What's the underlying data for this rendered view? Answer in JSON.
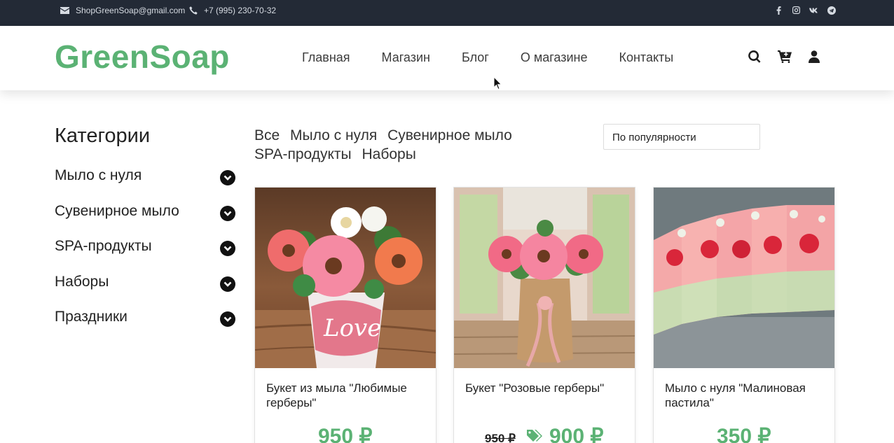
{
  "topbar": {
    "email": "ShopGreenSoap@gmail.com",
    "phone": "+7 (995) 230-70-32",
    "social_icons": [
      "facebook-icon",
      "instagram-icon",
      "vk-icon",
      "telegram-icon"
    ]
  },
  "header": {
    "logo": "GreenSoap",
    "nav": [
      "Главная",
      "Магазин",
      "Блог",
      "О магазине",
      "Контакты"
    ],
    "icons": [
      "search-icon",
      "cart-icon",
      "user-icon"
    ]
  },
  "sidebar": {
    "title": "Категории",
    "categories": [
      "Мыло с нуля",
      "Сувенирное мыло",
      "SPA-продукты",
      "Наборы",
      "Праздники"
    ]
  },
  "filters": {
    "tabs": [
      "Все",
      "Мыло с нуля",
      "Сувенирное мыло",
      "SPA-продукты",
      "Наборы"
    ],
    "sort_value": "По популярности"
  },
  "products": [
    {
      "name": "Букет из мыла \"Любимые герберы\"",
      "price": "950 ₽"
    },
    {
      "name": "Букет \"Розовые герберы\"",
      "old_price": "950 ₽",
      "price": "900 ₽"
    },
    {
      "name": "Мыло с нуля \"Малиновая пастила\"",
      "price": "350 ₽"
    }
  ],
  "colors": {
    "brand": "#5bb274",
    "topbar": "#232a36"
  }
}
